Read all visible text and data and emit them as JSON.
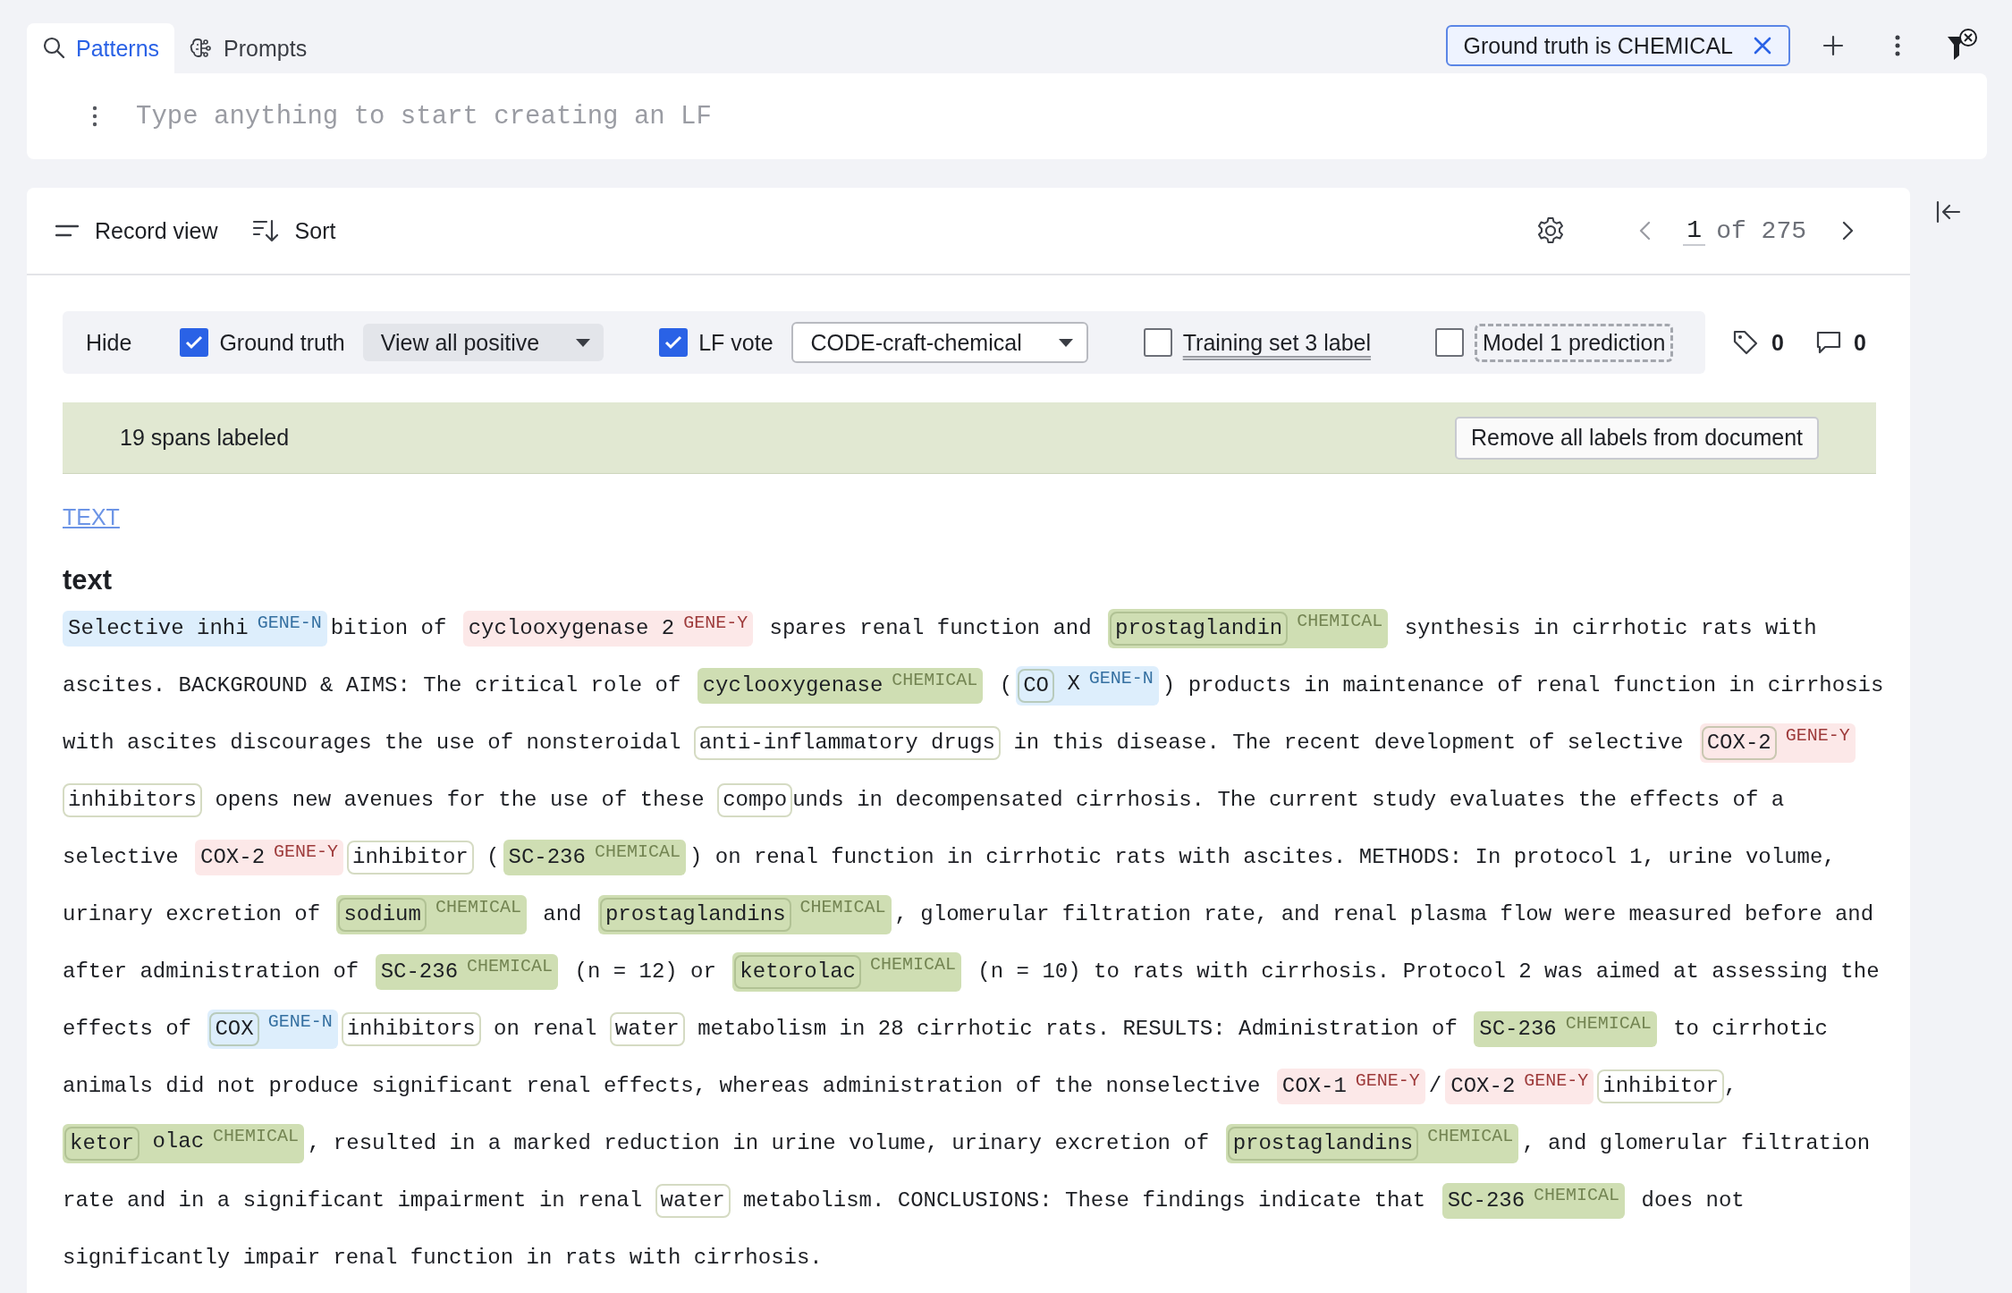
{
  "tabs": [
    {
      "label": "Patterns",
      "selected": true
    },
    {
      "label": "Prompts",
      "selected": false
    }
  ],
  "filter_chip": {
    "label": "Ground truth is CHEMICAL"
  },
  "lf_input": {
    "placeholder": "Type anything to start creating an LF"
  },
  "record_toolbar": {
    "view": "Record view",
    "sort": "Sort",
    "page": "1",
    "page_total": "of 275"
  },
  "display_options": {
    "hide": "Hide",
    "items": [
      {
        "kind": "checkbox",
        "label": "Ground truth",
        "checked": true
      },
      {
        "kind": "select",
        "value": "View all positive",
        "outlined": false
      },
      {
        "kind": "checkbox",
        "label": "LF vote",
        "checked": true
      },
      {
        "kind": "select",
        "value": "CODE-craft-chemical",
        "outlined": true
      },
      {
        "kind": "checkbox-underlined",
        "label": "Training set 3 label",
        "checked": false
      },
      {
        "kind": "checkbox-dashed",
        "label": "Model 1 prediction",
        "checked": false
      }
    ],
    "tag_count": "0",
    "comment_count": "0"
  },
  "banner": {
    "text": "19 spans labeled",
    "button": "Remove all labels from document"
  },
  "field_link": "TEXT",
  "field_name": "text",
  "lines": [
    [
      {
        "kind": "label",
        "tag": "GENE-N",
        "color": "#ddeefc",
        "parts": [
          {
            "text": "Selective inhi",
            "lf": false
          }
        ]
      },
      {
        "kind": "plain",
        "text": "bition of "
      },
      {
        "kind": "label",
        "tag": "GENE-Y",
        "color": "#fce8e8",
        "parts": [
          {
            "text": "cyclooxygenase 2",
            "lf": false
          }
        ]
      },
      {
        "kind": "plain",
        "text": " spares renal function and "
      },
      {
        "kind": "label",
        "tag": "CHEMICAL",
        "color": "#cfdeb3",
        "parts": [
          {
            "text": "prostaglandin",
            "lf": true
          }
        ]
      },
      {
        "kind": "plain",
        "text": " synthesis in cirrhotic rats with"
      }
    ],
    [
      {
        "kind": "plain",
        "text": "ascites. BACKGROUND & AIMS: The critical role of "
      },
      {
        "kind": "label",
        "tag": "CHEMICAL",
        "color": "#cfdeb3",
        "parts": [
          {
            "text": "cyclooxygenase",
            "lf": false
          }
        ]
      },
      {
        "kind": "plain",
        "text": " ("
      },
      {
        "kind": "label",
        "tag": "GENE-N",
        "color": "#ddeefc",
        "parts": [
          {
            "text": "CO",
            "lf": true
          },
          {
            "text": " X",
            "lf": false
          }
        ]
      },
      {
        "kind": "plain",
        "text": ") products in maintenance of renal function in cirrhosis"
      }
    ],
    [
      {
        "kind": "plain",
        "text": "with ascites discourages the use of nonsteroidal "
      },
      {
        "kind": "outline",
        "text": "anti-inflammatory drugs"
      },
      {
        "kind": "plain",
        "text": " in this disease. The recent development of selective "
      },
      {
        "kind": "label",
        "tag": "GENE-Y",
        "color": "#fce8e8",
        "parts": [
          {
            "text": "COX-2",
            "lf": true
          }
        ]
      }
    ],
    [
      {
        "kind": "outline",
        "text": "inhibitors"
      },
      {
        "kind": "plain",
        "text": " opens new avenues for the use of these "
      },
      {
        "kind": "outline",
        "text": "compo"
      },
      {
        "kind": "plain",
        "text": "unds in decompensated cirrhosis. The current study evaluates the effects of a"
      }
    ],
    [
      {
        "kind": "plain",
        "text": "selective "
      },
      {
        "kind": "label",
        "tag": "GENE-Y",
        "color": "#fce8e8",
        "parts": [
          {
            "text": "COX-2",
            "lf": false
          }
        ]
      },
      {
        "kind": "outline",
        "text": "inhibitor"
      },
      {
        "kind": "plain",
        "text": " ("
      },
      {
        "kind": "label",
        "tag": "CHEMICAL",
        "color": "#cfdeb3",
        "parts": [
          {
            "text": "SC-236",
            "lf": false
          }
        ]
      },
      {
        "kind": "plain",
        "text": ") on renal function in cirrhotic rats with ascites. METHODS: In protocol 1, urine volume,"
      }
    ],
    [
      {
        "kind": "plain",
        "text": "urinary excretion of "
      },
      {
        "kind": "label",
        "tag": "CHEMICAL",
        "color": "#cfdeb3",
        "parts": [
          {
            "text": "sodium",
            "lf": true
          }
        ]
      },
      {
        "kind": "plain",
        "text": " and "
      },
      {
        "kind": "label",
        "tag": "CHEMICAL",
        "color": "#cfdeb3",
        "parts": [
          {
            "text": "prostaglandins",
            "lf": true
          }
        ]
      },
      {
        "kind": "plain",
        "text": ", glomerular filtration rate, and renal plasma flow were measured before and"
      }
    ],
    [
      {
        "kind": "plain",
        "text": "after administration of "
      },
      {
        "kind": "label",
        "tag": "CHEMICAL",
        "color": "#cfdeb3",
        "parts": [
          {
            "text": "SC-236",
            "lf": false
          }
        ]
      },
      {
        "kind": "plain",
        "text": " (n = 12) or "
      },
      {
        "kind": "label",
        "tag": "CHEMICAL",
        "color": "#cfdeb3",
        "parts": [
          {
            "text": "ketorolac",
            "lf": true
          }
        ]
      },
      {
        "kind": "plain",
        "text": " (n = 10) to rats with cirrhosis. Protocol 2 was aimed at assessing the"
      }
    ],
    [
      {
        "kind": "plain",
        "text": "effects of "
      },
      {
        "kind": "label",
        "tag": "GENE-N",
        "color": "#ddeefc",
        "parts": [
          {
            "text": "COX",
            "lf": true
          }
        ]
      },
      {
        "kind": "outline",
        "text": "inhibitors"
      },
      {
        "kind": "plain",
        "text": " on renal "
      },
      {
        "kind": "outline",
        "text": "water"
      },
      {
        "kind": "plain",
        "text": " metabolism in 28 cirrhotic rats. RESULTS: Administration of "
      },
      {
        "kind": "label",
        "tag": "CHEMICAL",
        "color": "#cfdeb3",
        "parts": [
          {
            "text": "SC-236",
            "lf": false
          }
        ]
      },
      {
        "kind": "plain",
        "text": " to cirrhotic"
      }
    ],
    [
      {
        "kind": "plain",
        "text": "animals did not produce significant renal effects, whereas administration of the nonselective "
      },
      {
        "kind": "label",
        "tag": "GENE-Y",
        "color": "#fce8e8",
        "parts": [
          {
            "text": "COX-1",
            "lf": false
          }
        ]
      },
      {
        "kind": "plain",
        "text": "/"
      },
      {
        "kind": "label",
        "tag": "GENE-Y",
        "color": "#fce8e8",
        "parts": [
          {
            "text": "COX-2",
            "lf": false
          }
        ]
      },
      {
        "kind": "outline",
        "text": "inhibitor"
      },
      {
        "kind": "plain",
        "text": ","
      }
    ],
    [
      {
        "kind": "label",
        "tag": "CHEMICAL",
        "color": "#cfdeb3",
        "parts": [
          {
            "text": "ketor",
            "lf": true
          },
          {
            "text": " olac",
            "lf": false
          }
        ]
      },
      {
        "kind": "plain",
        "text": ", resulted in a marked reduction in urine volume, urinary excretion of "
      },
      {
        "kind": "label",
        "tag": "CHEMICAL",
        "color": "#cfdeb3",
        "parts": [
          {
            "text": "prostaglandins",
            "lf": true
          }
        ]
      },
      {
        "kind": "plain",
        "text": ", and glomerular filtration"
      }
    ],
    [
      {
        "kind": "plain",
        "text": "rate and in a significant impairment in renal "
      },
      {
        "kind": "outline",
        "text": "water"
      },
      {
        "kind": "plain",
        "text": " metabolism. CONCLUSIONS: These findings indicate that "
      },
      {
        "kind": "label",
        "tag": "CHEMICAL",
        "color": "#cfdeb3",
        "parts": [
          {
            "text": "SC-236",
            "lf": false
          }
        ]
      },
      {
        "kind": "plain",
        "text": " does not"
      }
    ],
    [
      {
        "kind": "plain",
        "text": "significantly impair renal function in rats with cirrhosis."
      }
    ]
  ]
}
